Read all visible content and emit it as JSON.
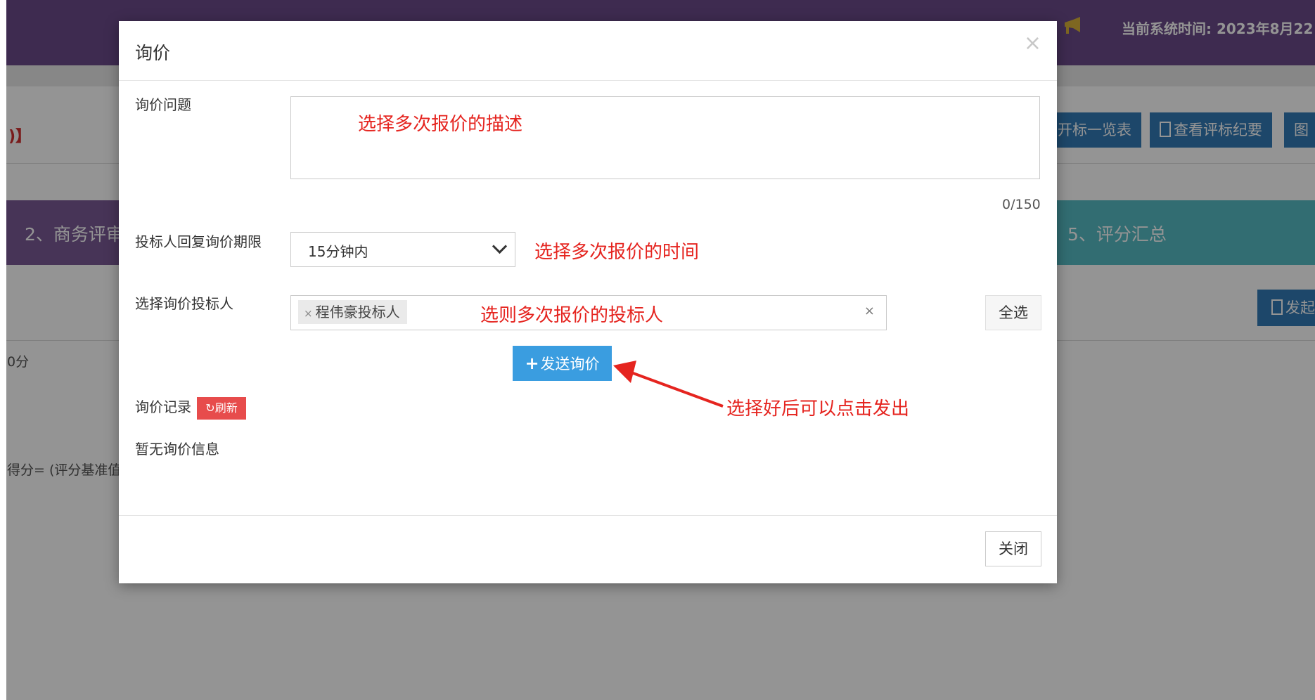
{
  "background": {
    "system_time": "当前系统时间: 2023年8月22",
    "bracket_fragment": ")】",
    "toolbar_buttons": [
      "开标一览表",
      "查看评标纪要",
      "图"
    ],
    "steps": [
      "2、商务评审",
      "5、评分汇总"
    ],
    "launch_button": "发起",
    "score_fragment": "0分",
    "formula_fragment": "得分= (评分基准值"
  },
  "modal": {
    "title": "询价",
    "question_label": "询价问题",
    "question_value": "",
    "char_counter": "0/150",
    "deadline_label": "投标人回复询价期限",
    "deadline_value": "15分钟内",
    "bidders_label": "选择询价投标人",
    "selected_bidders": [
      "程伟豪投标人"
    ],
    "select_all_label": "全选",
    "send_button_label": "发送询价",
    "history_label": "询价记录",
    "refresh_button_label": "刷新",
    "empty_message": "暂无询价信息",
    "close_button_label": "关闭"
  },
  "annotations": {
    "question_hint": "选择多次报价的描述",
    "deadline_hint": "选择多次报价的时间",
    "bidders_hint": "选则多次报价的投标人",
    "send_hint": "选择好后可以点击发出"
  },
  "colors": {
    "header_purple": "#6c4b8a",
    "primary_blue": "#337ab7",
    "send_blue": "#3a9de0",
    "annotation_red": "#e5241f",
    "refresh_red": "#e74c4c",
    "step_teal": "#56bcc4"
  },
  "icons": {
    "announcement": "megaphone-icon",
    "close": "close-icon",
    "dropdown": "chevron-down-icon",
    "refresh": "refresh-icon",
    "add": "plus-icon"
  }
}
